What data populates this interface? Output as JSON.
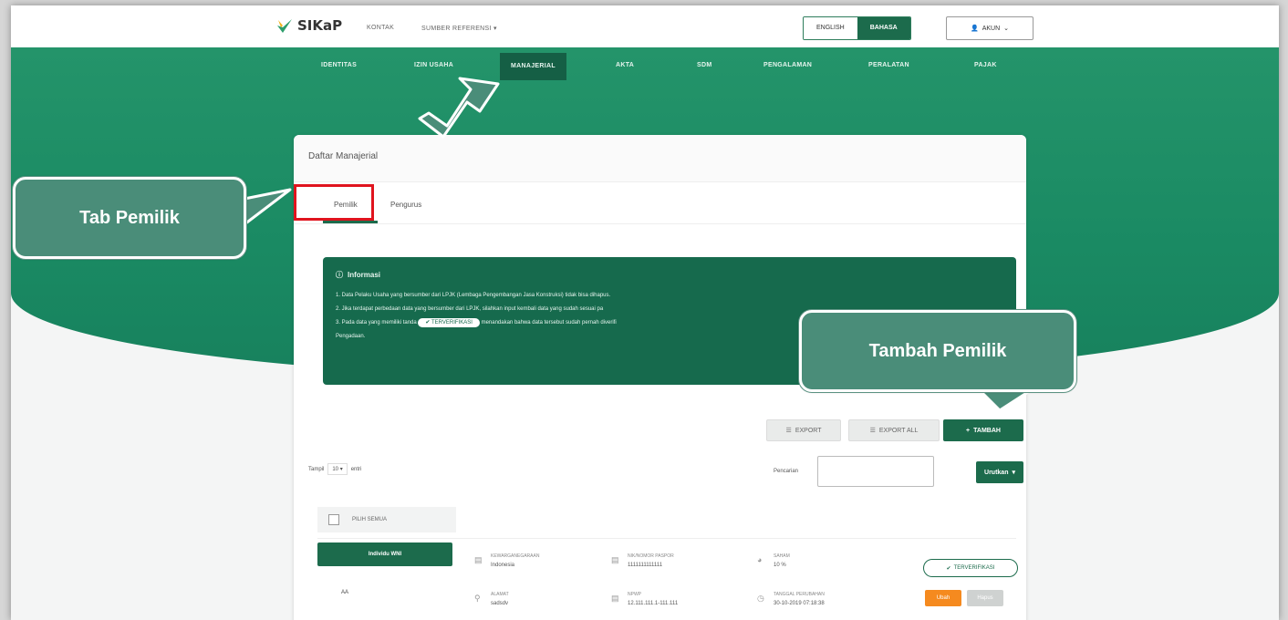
{
  "app": {
    "logo_text": "SIKaP",
    "nav_links": [
      "KONTAK",
      "SUMBER REFERENSI"
    ],
    "language": {
      "english": "ENGLISH",
      "bahasa": "BAHASA"
    },
    "account_label": "AKUN"
  },
  "menu": {
    "items": [
      "IDENTITAS",
      "IZIN USAHA",
      "MANAJERIAL",
      "AKTA",
      "SDM",
      "PENGALAMAN",
      "PERALATAN",
      "PAJAK"
    ],
    "active": "MANAJERIAL"
  },
  "card": {
    "title": "Daftar Manajerial",
    "tabs": [
      "Pemilik",
      "Pengurus"
    ],
    "active_tab": "Pemilik"
  },
  "info": {
    "title": "Informasi",
    "line1": "1. Data Pelaku Usaha yang bersumber dari LPJK (Lembaga Pengembangan Jasa Konstruksi) tidak bisa dihapus.",
    "line2": "2. Jika terdapat perbedaan data yang bersumber dari LPJK, silahkan input kembali data yang sudah sesuai pa",
    "line3_a": "3. Pada data yang memiliki tanda",
    "line3_badge": "✔ TERVERIFIKASI",
    "line3_b": "menandakan bahwa data tersebut sudah pernah diverifi",
    "line4": "Pengadaan."
  },
  "toolbar": {
    "export": "EXPORT",
    "export_all": "EXPORT ALL",
    "tambah": "TAMBAH",
    "show_prefix": "Tampil",
    "show_value": "10",
    "show_suffix": "entri",
    "search_label": "Pencarian",
    "search_value": "",
    "sort_label": "Urutkan"
  },
  "filter": {
    "label": "PILIH SEMUA"
  },
  "row": {
    "tag": "Individu WNI",
    "name": "AA",
    "kewarganegaraan_label": "KEWARGANEGARAAN",
    "kewarganegaraan_value": "Indonesia",
    "alamat_label": "ALAMAT",
    "alamat_value": "sadsdv",
    "ktp_label": "NIK/NOMOR PASPOR",
    "ktp_value": "1111111111111",
    "npwp_label": "NPWP",
    "npwp_value": "12.111.111.1-111.111",
    "saham_label": "SAHAM",
    "saham_value": "10 %",
    "tanggal_label": "TANGGAL PERUBAHAN",
    "tanggal_value": "30-10-2019 07:18:38",
    "verified": "TERVERIFIKASI",
    "ubah": "Ubah",
    "hapus": "Hapus"
  },
  "annotations": {
    "tab_pemilik": "Tab Pemilik",
    "tambah_pemilik": "Tambah Pemilik"
  },
  "colors": {
    "brand_green": "#1c6b4c",
    "banner_green": "#1a8a63",
    "callout": "#4a8d79",
    "highlight_red": "#e0141e",
    "edit_orange": "#f58a1f"
  }
}
